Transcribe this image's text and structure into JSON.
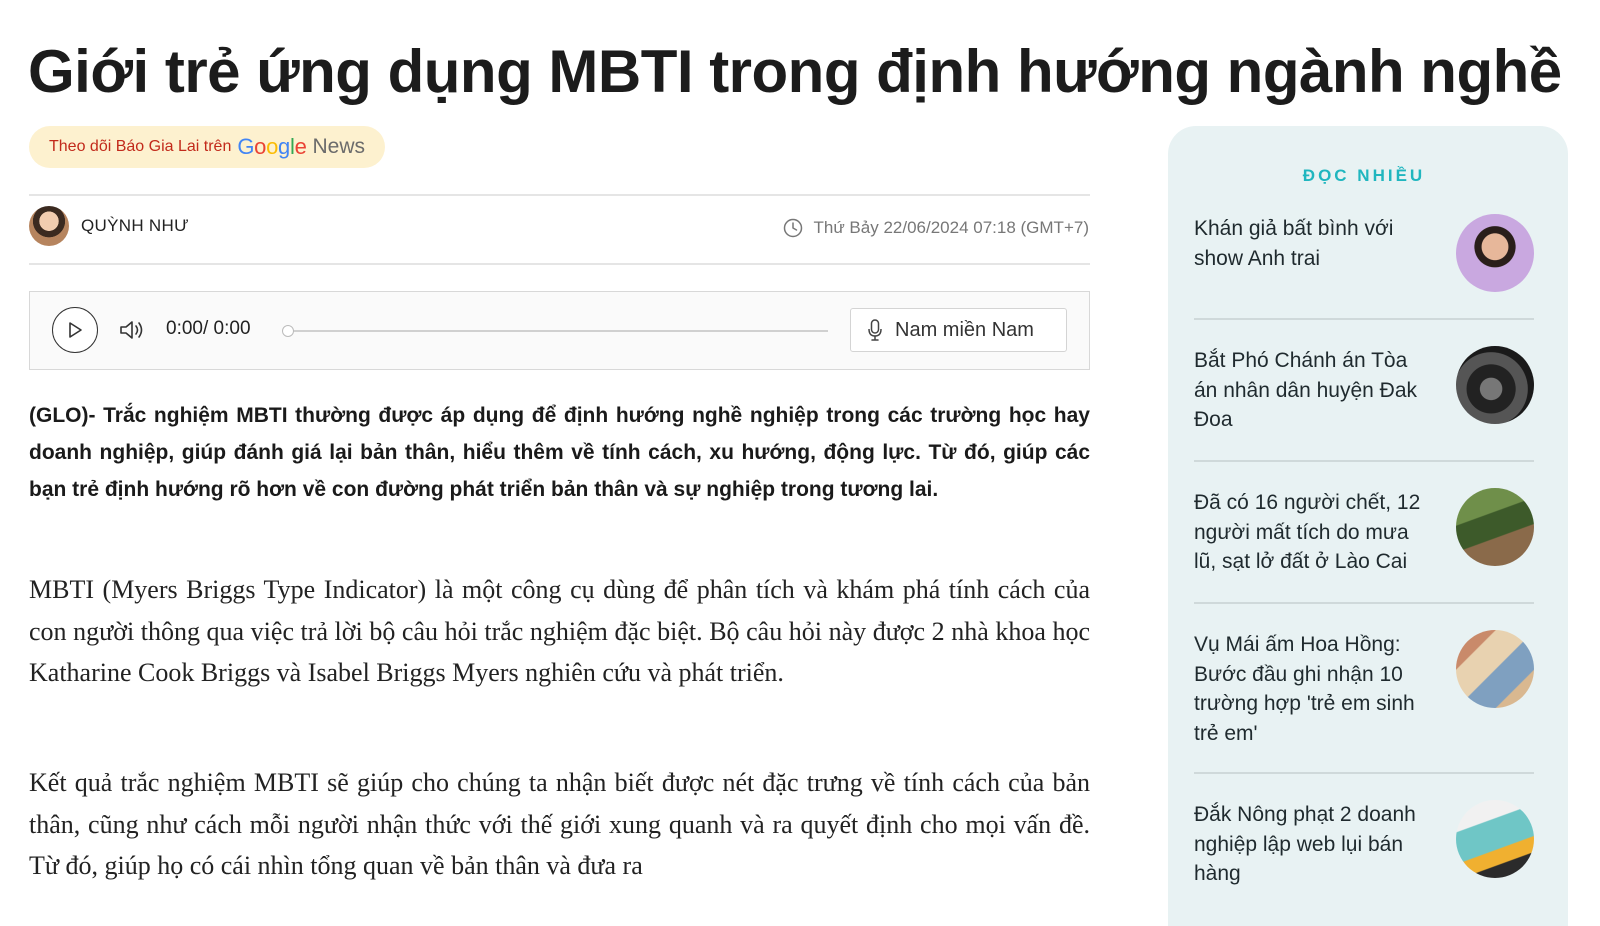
{
  "article": {
    "title": "Giới trẻ ứng dụng MBTI trong định hướng ngành nghề",
    "google_news": {
      "follow": "Theo dõi Báo Gia Lai trên",
      "google": "Google",
      "news": "News"
    },
    "author": "QUỲNH NHƯ",
    "datetime": "Thứ Bảy 22/06/2024 07:18 (GMT+7)",
    "player": {
      "time": "0:00/ 0:00",
      "progress": 0,
      "voice": "Nam miền Nam"
    },
    "sapo": "(GLO)- Trắc nghiệm MBTI thường được áp dụng để định hướng nghề nghiệp trong các trường học hay doanh nghiệp, giúp đánh giá lại bản thân, hiểu thêm về tính cách, xu hướng, động lực. Từ đó, giúp các bạn trẻ định hướng rõ hơn về con đường phát triển bản thân và sự nghiệp trong tương lai.",
    "paragraphs": [
      "MBTI (Myers Briggs Type Indicator) là một công cụ dùng để phân tích và khám phá tính cách của con người thông qua việc trả lời bộ câu hỏi trắc nghiệm đặc biệt. Bộ câu hỏi này được 2 nhà khoa học Katharine Cook Briggs và Isabel Briggs Myers nghiên cứu và phát triển.",
      "Kết quả trắc nghiệm MBTI sẽ giúp cho chúng ta nhận biết được nét đặc trưng về tính cách của bản thân, cũng như cách mỗi người nhận thức với thế giới xung quanh và ra quyết định cho mọi vấn đề. Từ đó, giúp họ có cái nhìn tổng quan về bản thân và đưa ra"
    ]
  },
  "sidebar": {
    "title": "ĐỌC NHIỀU",
    "items": [
      {
        "title": "Khán giả bất bình với show Anh trai"
      },
      {
        "title": "Bắt Phó Chánh án Tòa án nhân dân huyện Đak Đoa"
      },
      {
        "title": "Đã có 16 người chết, 12 người mất tích do mưa lũ, sạt lở đất ở Lào Cai"
      },
      {
        "title": "Vụ Mái ấm Hoa Hồng: Bước đầu ghi nhận 10 trường hợp 'trẻ em sinh trẻ em'"
      },
      {
        "title": "Đắk Nông phạt 2 doanh nghiệp lập web lụi bán hàng"
      }
    ]
  },
  "colors": {
    "accent": "#20b6bf",
    "follow_text": "#c22a1b",
    "pill_bg": "#fdf1cf",
    "sidebar_bg": "#e8f2f3"
  },
  "icons": [
    "clock-icon",
    "play-icon",
    "speaker-icon",
    "microphone-icon"
  ]
}
